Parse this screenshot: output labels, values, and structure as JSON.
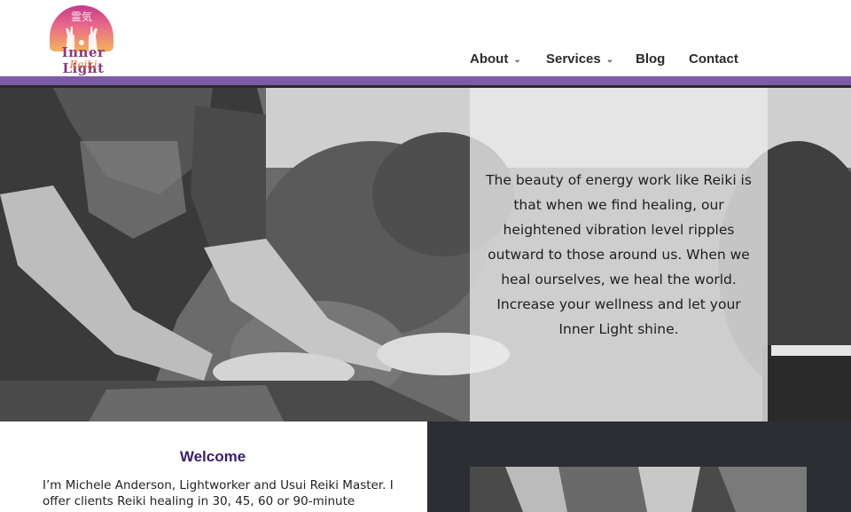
{
  "logo": {
    "glyph": "霊気",
    "name": "Inner Light",
    "script": "Reiki"
  },
  "nav": {
    "items": [
      {
        "label": "About",
        "has_dropdown": true
      },
      {
        "label": "Services",
        "has_dropdown": true
      },
      {
        "label": "Blog",
        "has_dropdown": false
      },
      {
        "label": "Contact",
        "has_dropdown": false
      }
    ]
  },
  "hero": {
    "quote": "The beauty of energy work like Reiki is that when we find healing, our heightened vibration level ripples outward to those around us. When we heal ourselves, we heal the world. Increase your wellness and let your Inner Light shine."
  },
  "welcome": {
    "title": "Welcome",
    "text": "I’m Michele Anderson, Lightworker and Usui Reiki Master. I offer clients Reiki healing in 30, 45, 60 or 90-minute"
  },
  "colors": {
    "accent_purple": "#7d5ba6",
    "title_purple": "#3a1e6e",
    "dark_panel": "#2b2f33"
  }
}
